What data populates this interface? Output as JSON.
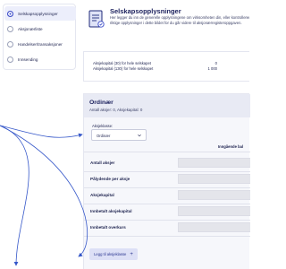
{
  "sidebar": {
    "items": [
      {
        "label": "Selskapsopplysninger",
        "active": true
      },
      {
        "label": "Aksjonærliste",
        "active": false
      },
      {
        "label": "Handelser/transaksjoner",
        "active": false
      },
      {
        "label": "Innsending",
        "active": false
      }
    ]
  },
  "header": {
    "title": "Selskapsopplysninger",
    "description_line1": "Her legger du inn de generelle opplysningene om virksomheten din, eller kontrollerer at",
    "description_line2": "riktige opplysninger i dette bildet for du går videre til aksjonærregisteroppgaven."
  },
  "capital": {
    "rows": [
      {
        "label": "Aksjekapital (30) for hele selskapet",
        "value": "0"
      },
      {
        "label": "Aksjekapital (130) for hele selskapet",
        "value": "1 000"
      }
    ]
  },
  "share_class": {
    "title": "Ordinær",
    "subtitle": "Antall aksjer: 0, Aksjekapital: 0",
    "select_label": "Aksjeklasse:",
    "select_value": "Ordinær",
    "column_header": "Inngående bal",
    "rows": [
      "Antall aksjer",
      "Pålydende per aksje",
      "Aksjekapital",
      "Innbetalt aksjekapital",
      "Innbetalt overkurs"
    ],
    "add_button_label": "Legg til aksjeklasse"
  },
  "colors": {
    "accent": "#3b4bc8",
    "arrow": "#3557c9",
    "title": "#1a1f5c"
  }
}
